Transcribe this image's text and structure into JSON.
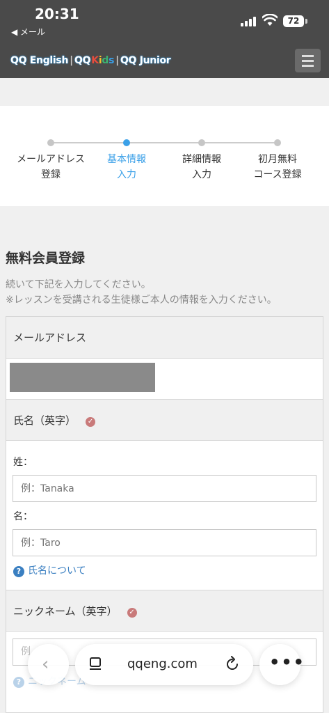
{
  "status_bar": {
    "time": "20:31",
    "back_app": "◀ メール",
    "battery": "72"
  },
  "header": {
    "logo_parts": [
      "QQ English",
      "QQ",
      "K",
      "i",
      "d",
      "s",
      "QQ Junior"
    ],
    "menu_icon": "hamburger-icon",
    "brand_colors": {
      "kids_k": "#e84c3d",
      "kids_i": "#f2c12e",
      "kids_d": "#3cb371",
      "kids_s": "#3aa0e8",
      "accent": "#3aa0e8"
    }
  },
  "stepper": {
    "steps": [
      {
        "line1": "メールアドレス",
        "line2": "登録",
        "active": false
      },
      {
        "line1": "基本情報",
        "line2": "入力",
        "active": true
      },
      {
        "line1": "詳細情報",
        "line2": "入力",
        "active": false
      },
      {
        "line1": "初月無料",
        "line2": "コース登録",
        "active": false
      }
    ]
  },
  "form": {
    "title": "無料会員登録",
    "desc_line1": "続いて下記を入力してください。",
    "desc_line2": "※レッスンを受講される生徒様ご本人の情報を入力ください。",
    "email_label": "メールアドレス",
    "name_label": "氏名（英字）",
    "last_name_label": "姓：",
    "last_name_placeholder": "例：Tanaka",
    "first_name_label": "名：",
    "first_name_placeholder": "例：Taro",
    "name_help": "氏名について",
    "nickname_label": "ニックネーム（英字）",
    "nickname_placeholder": "例",
    "nickname_help": "ニックネーム"
  },
  "browser": {
    "url": "qqeng.com"
  }
}
